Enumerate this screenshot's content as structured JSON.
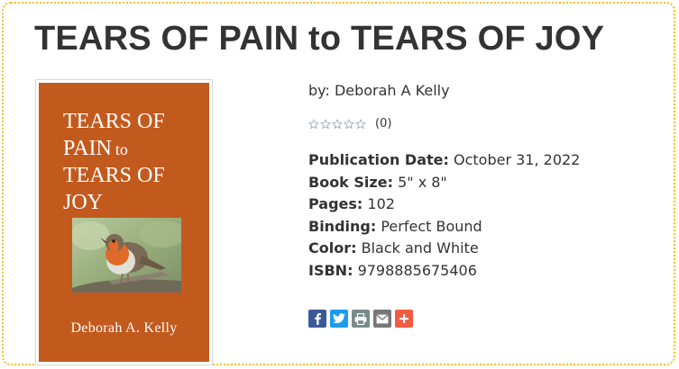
{
  "page": {
    "title": "TEARS OF PAIN to TEARS OF JOY"
  },
  "cover": {
    "title_lines": [
      "TEARS OF",
      "PAIN",
      "to",
      "TEARS OF",
      "JOY"
    ],
    "author": "Deborah A. Kelly",
    "image": "robin-bird-photo",
    "background_color": "#c25a1e"
  },
  "book": {
    "byline": "by: Deborah A Kelly",
    "rating": {
      "stars": 0,
      "max_stars": 5,
      "count_text": "(0)"
    },
    "details": [
      {
        "label": "Publication Date:",
        "value": "October 31, 2022"
      },
      {
        "label": "Book Size:",
        "value": "5\" x 8\""
      },
      {
        "label": "Pages:",
        "value": "102"
      },
      {
        "label": "Binding:",
        "value": "Perfect Bound"
      },
      {
        "label": "Color:",
        "value": "Black and White"
      },
      {
        "label": "ISBN:",
        "value": "9798885675406"
      }
    ]
  },
  "share": [
    {
      "name": "facebook",
      "icon": "facebook-icon",
      "color": "#3b5998"
    },
    {
      "name": "twitter",
      "icon": "twitter-icon",
      "color": "#1d9bf0"
    },
    {
      "name": "print",
      "icon": "print-icon",
      "color": "#7a8a8a"
    },
    {
      "name": "email",
      "icon": "email-icon",
      "color": "#777777"
    },
    {
      "name": "more",
      "icon": "plus-icon",
      "color": "#f25a41"
    }
  ],
  "colors": {
    "frame_border": "#f0c030",
    "text": "#333333"
  }
}
